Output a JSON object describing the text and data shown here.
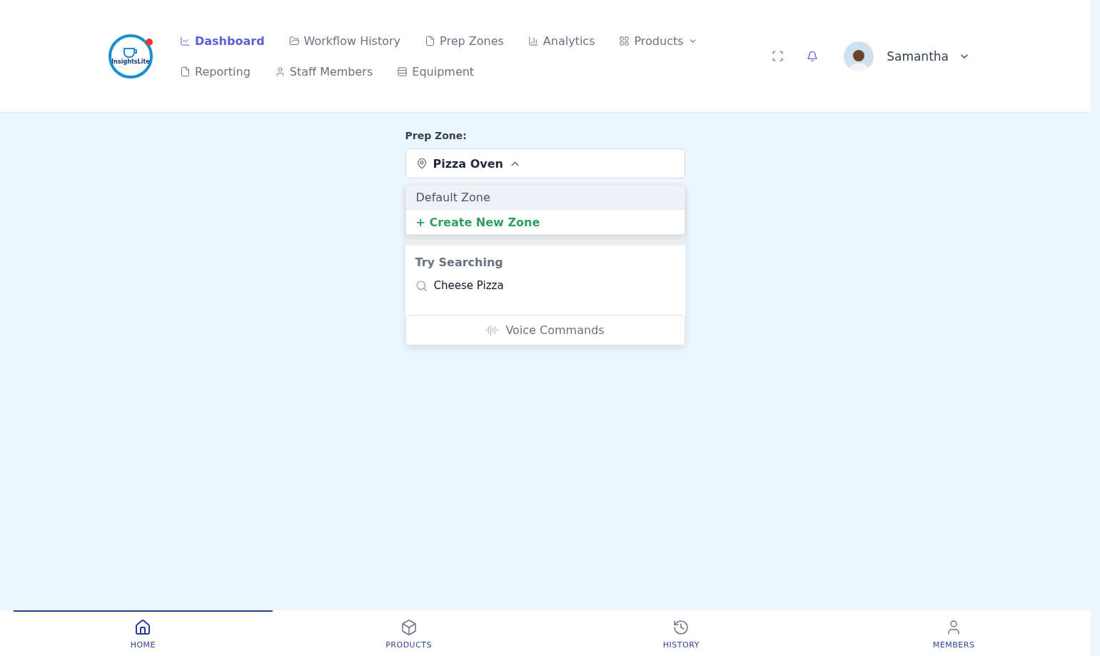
{
  "logo": {
    "text": "InsightsLite"
  },
  "nav": [
    {
      "label": "Dashboard",
      "kind": "link",
      "selected": true
    },
    {
      "label": "Workflow History",
      "kind": "link",
      "selected": false
    },
    {
      "label": "Prep Zones",
      "kind": "link",
      "selected": false
    },
    {
      "label": "Analytics",
      "kind": "link",
      "selected": false
    },
    {
      "label": "Products",
      "kind": "menu",
      "selected": false
    },
    {
      "label": "Reporting",
      "kind": "link",
      "selected": false
    },
    {
      "label": "Staff Members",
      "kind": "link",
      "selected": false
    },
    {
      "label": "Equipment",
      "kind": "link",
      "selected": false
    }
  ],
  "user": {
    "name": "Samantha"
  },
  "prep_zone": {
    "label": "Prep Zone:",
    "value": "Pizza Oven",
    "expanded": true,
    "options": [
      {
        "label": "Default Zone",
        "kind": "option",
        "selected": true
      },
      {
        "label": "+ Create New Zone",
        "kind": "create",
        "selected": false
      }
    ]
  },
  "suggestions": {
    "subtitle": "Try Searching",
    "items": [
      "Cheese Pizza"
    ],
    "voice_button": "Voice Commands"
  },
  "bottom_nav": [
    {
      "label": "HOME",
      "selected": true
    },
    {
      "label": "PRODUCTS",
      "selected": false
    },
    {
      "label": "HISTORY",
      "selected": false
    },
    {
      "label": "MEMBERS",
      "selected": false
    }
  ]
}
